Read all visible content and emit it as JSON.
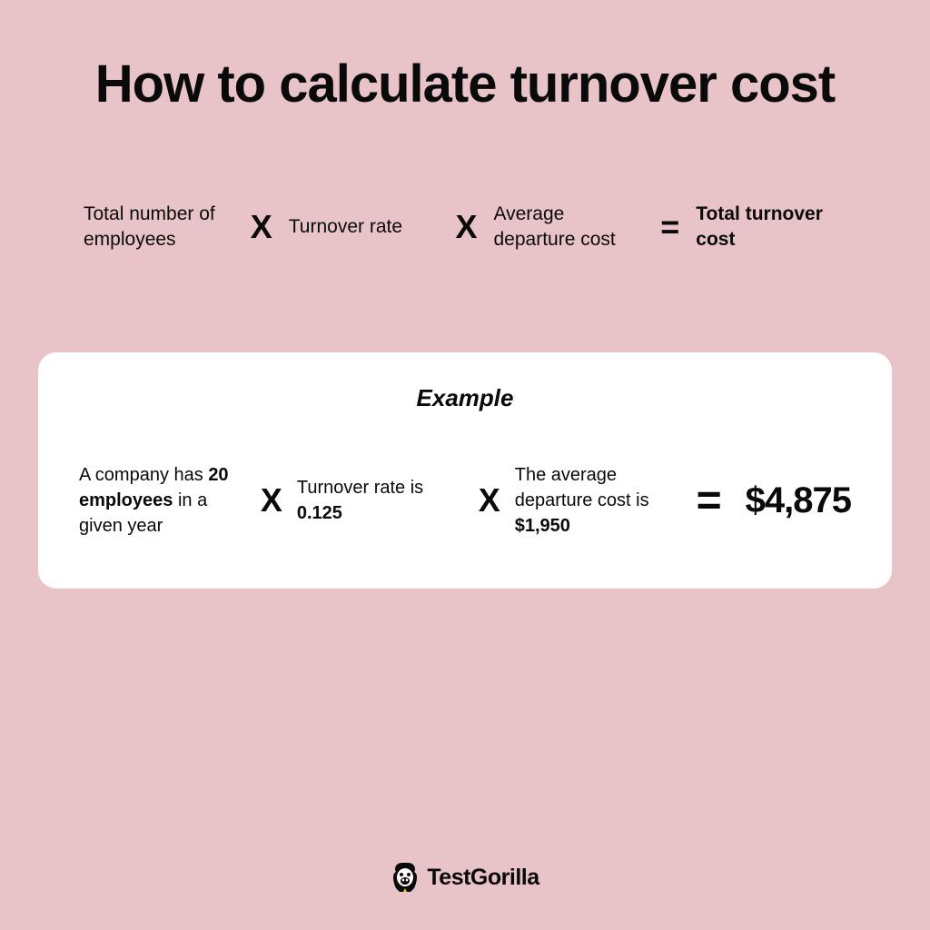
{
  "title": "How to calculate turnover cost",
  "formula": {
    "term1": "Total number of employees",
    "op1": "X",
    "term2": "Turnover rate",
    "op2": "X",
    "term3": "Average departure cost",
    "eq": "=",
    "result": "Total turnover cost"
  },
  "example": {
    "heading": "Example",
    "term1_pre": "A company has ",
    "term1_bold": "20 employees",
    "term1_post": " in a given year",
    "op1": "X",
    "term2_pre": "Turnover rate is ",
    "term2_bold": "0.125",
    "op2": "X",
    "term3_pre": "The average departure cost is ",
    "term3_bold": "$1,950",
    "eq": "=",
    "result": "$4,875"
  },
  "brand": "TestGorilla"
}
